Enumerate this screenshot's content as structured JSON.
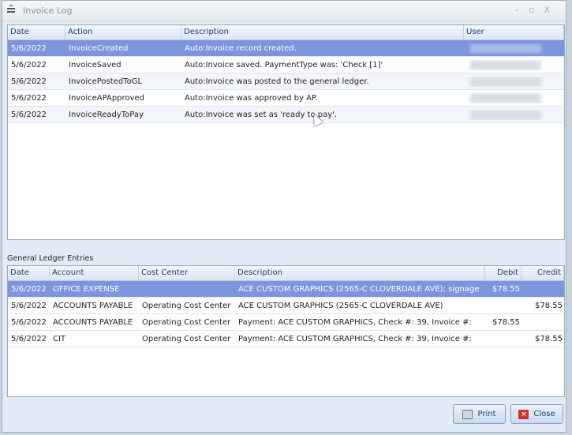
{
  "window": {
    "title": "Invoice Log",
    "controls": [
      "–",
      "▫",
      "X"
    ]
  },
  "log": {
    "columns": [
      "Date",
      "Action",
      "Description",
      "User"
    ],
    "rows": [
      {
        "date": "5/6/2022",
        "action": "InvoiceCreated",
        "description": "Auto:Invoice record created."
      },
      {
        "date": "5/6/2022",
        "action": "InvoiceSaved",
        "description": "Auto:Invoice saved. PaymentType was: 'Check [1]'"
      },
      {
        "date": "5/6/2022",
        "action": "InvoicePostedToGL",
        "description": "Auto:Invoice was posted to the general ledger."
      },
      {
        "date": "5/6/2022",
        "action": "InvoiceAPApproved",
        "description": "Auto:Invoice was approved by AP."
      },
      {
        "date": "5/6/2022",
        "action": "InvoiceReadyToPay",
        "description": "Auto:Invoice was set as 'ready to pay'."
      }
    ]
  },
  "gl": {
    "label": "General Ledger Entries",
    "columns": [
      "Date",
      "Account",
      "Cost Center",
      "Description",
      "Debit",
      "Credit"
    ],
    "rows": [
      {
        "date": "5/6/2022",
        "account": "OFFICE EXPENSE",
        "cost_center": "",
        "description": "ACE CUSTOM GRAPHICS (2565-C CLOVERDALE AVE); signage",
        "debit": "$78.55",
        "credit": ""
      },
      {
        "date": "5/6/2022",
        "account": "ACCOUNTS PAYABLE",
        "cost_center": "Operating Cost Center",
        "description": "ACE CUSTOM GRAPHICS (2565-C CLOVERDALE AVE)",
        "debit": "",
        "credit": "$78.55"
      },
      {
        "date": "5/6/2022",
        "account": "ACCOUNTS PAYABLE",
        "cost_center": "Operating Cost Center",
        "description": "Payment: ACE CUSTOM GRAPHICS, Check #: 39, Invoice #:",
        "debit": "$78.55",
        "credit": ""
      },
      {
        "date": "5/6/2022",
        "account": "CIT",
        "cost_center": "Operating Cost Center",
        "description": "Payment: ACE CUSTOM GRAPHICS, Check #: 39, Invoice #:",
        "debit": "",
        "credit": "$78.55"
      }
    ]
  },
  "buttons": {
    "print": "Print",
    "close": "Close"
  }
}
